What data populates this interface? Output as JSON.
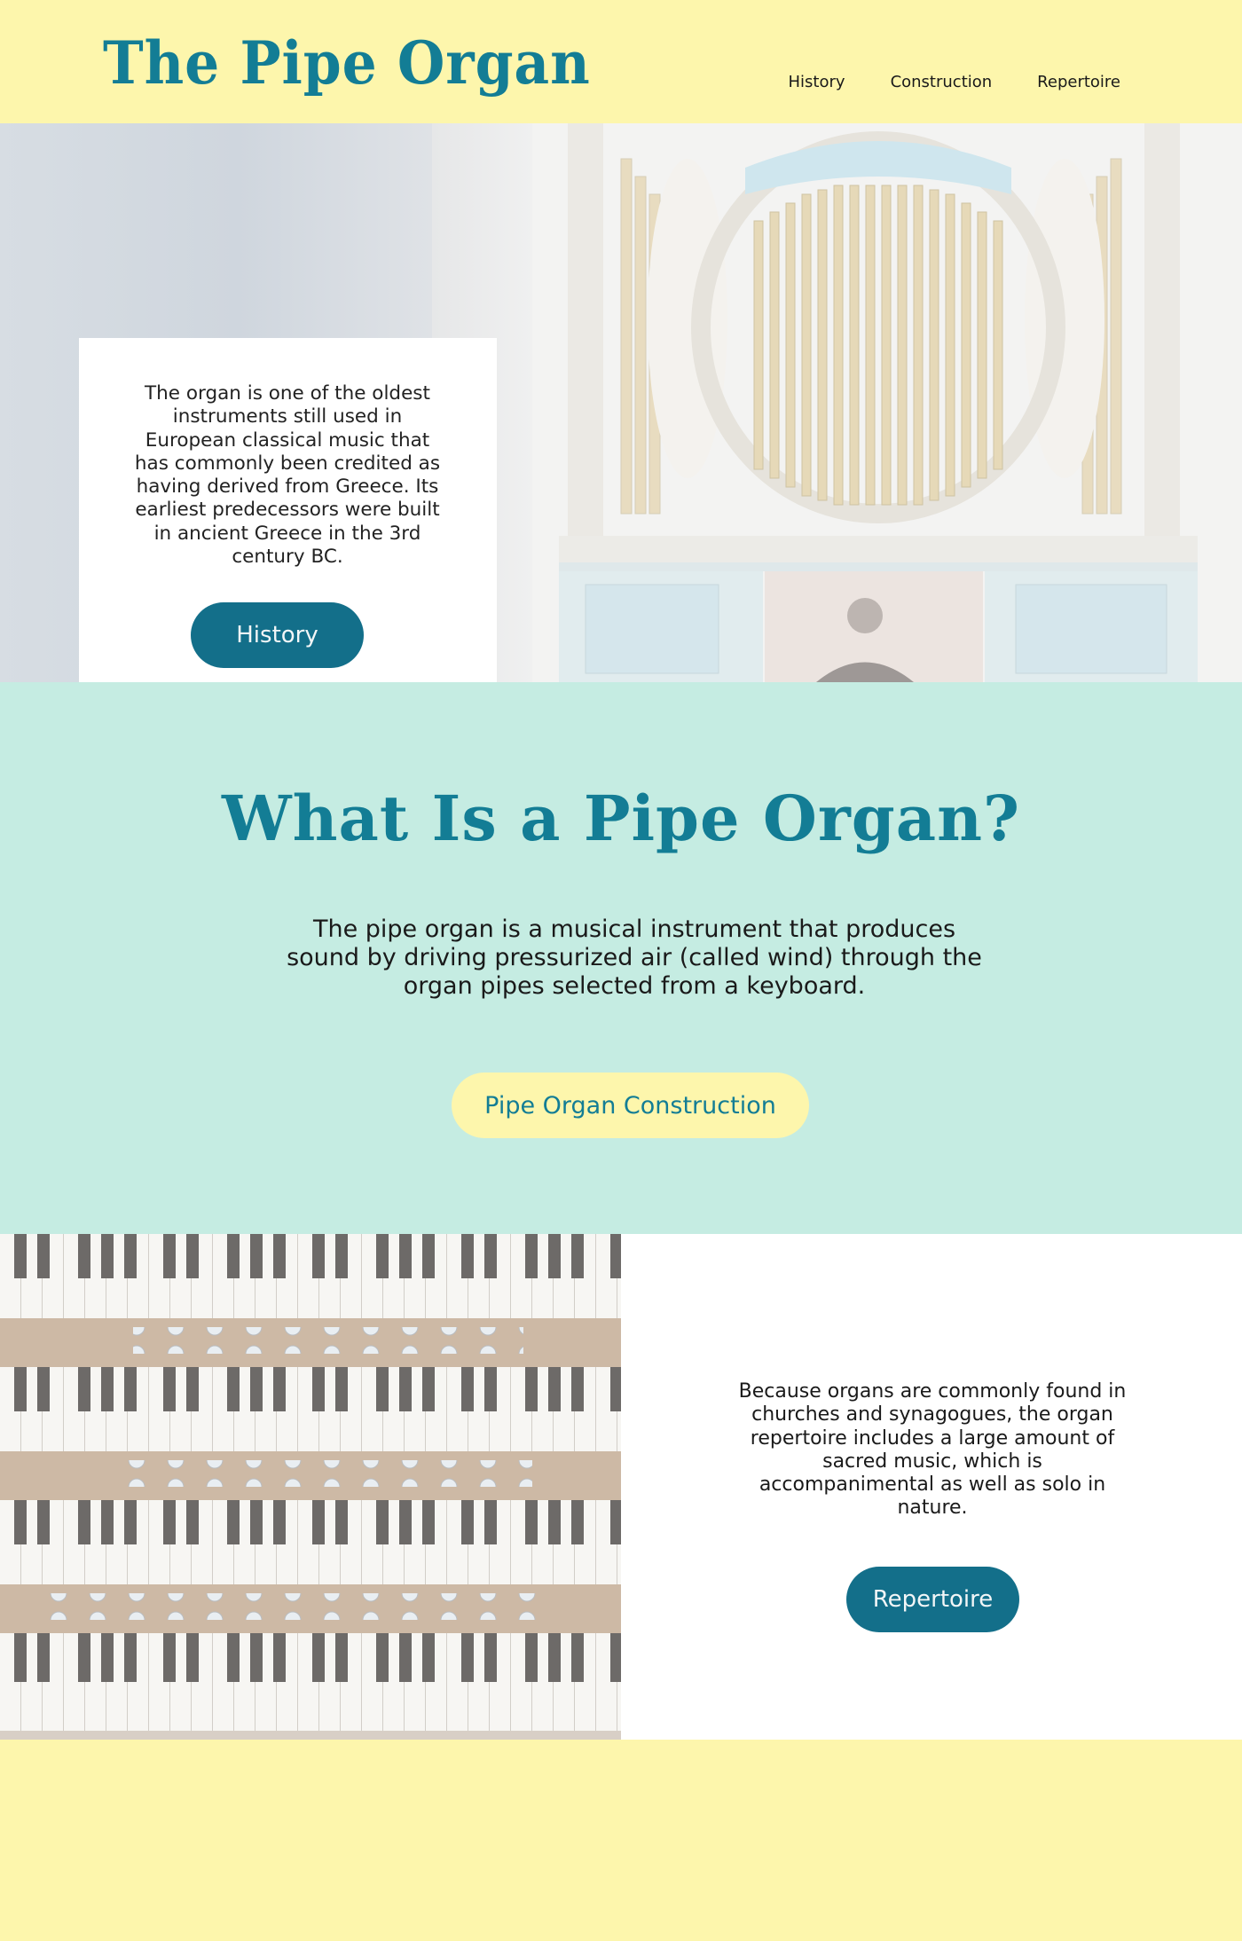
{
  "site": {
    "logo": "The Pipe Organ"
  },
  "nav": {
    "items": [
      "History",
      "Construction",
      "Repertoire"
    ]
  },
  "hero": {
    "text": "The organ is one of the oldest instruments still used in European classical music that has commonly been credited as having derived from Greece. Its earliest predecessors were built in ancient Greece in the 3rd century BC.",
    "button": "History"
  },
  "about": {
    "title": "What Is a Pipe Organ?",
    "text": "The pipe organ is a musical instrument that produces sound by driving pressurized air (called wind) through the organ pipes selected from a keyboard.",
    "button": "Pipe Organ Construction"
  },
  "repertoire": {
    "text": "Because organs are commonly found in churches and synagogues, the organ repertoire includes a large amount of sacred music, which is accompanimental as well as solo in nature.",
    "button": "Repertoire"
  },
  "colors": {
    "yellow": "#fdf6ac",
    "mint": "#c5ece2",
    "teal": "#137d95",
    "button_dark": "#136f8a"
  }
}
